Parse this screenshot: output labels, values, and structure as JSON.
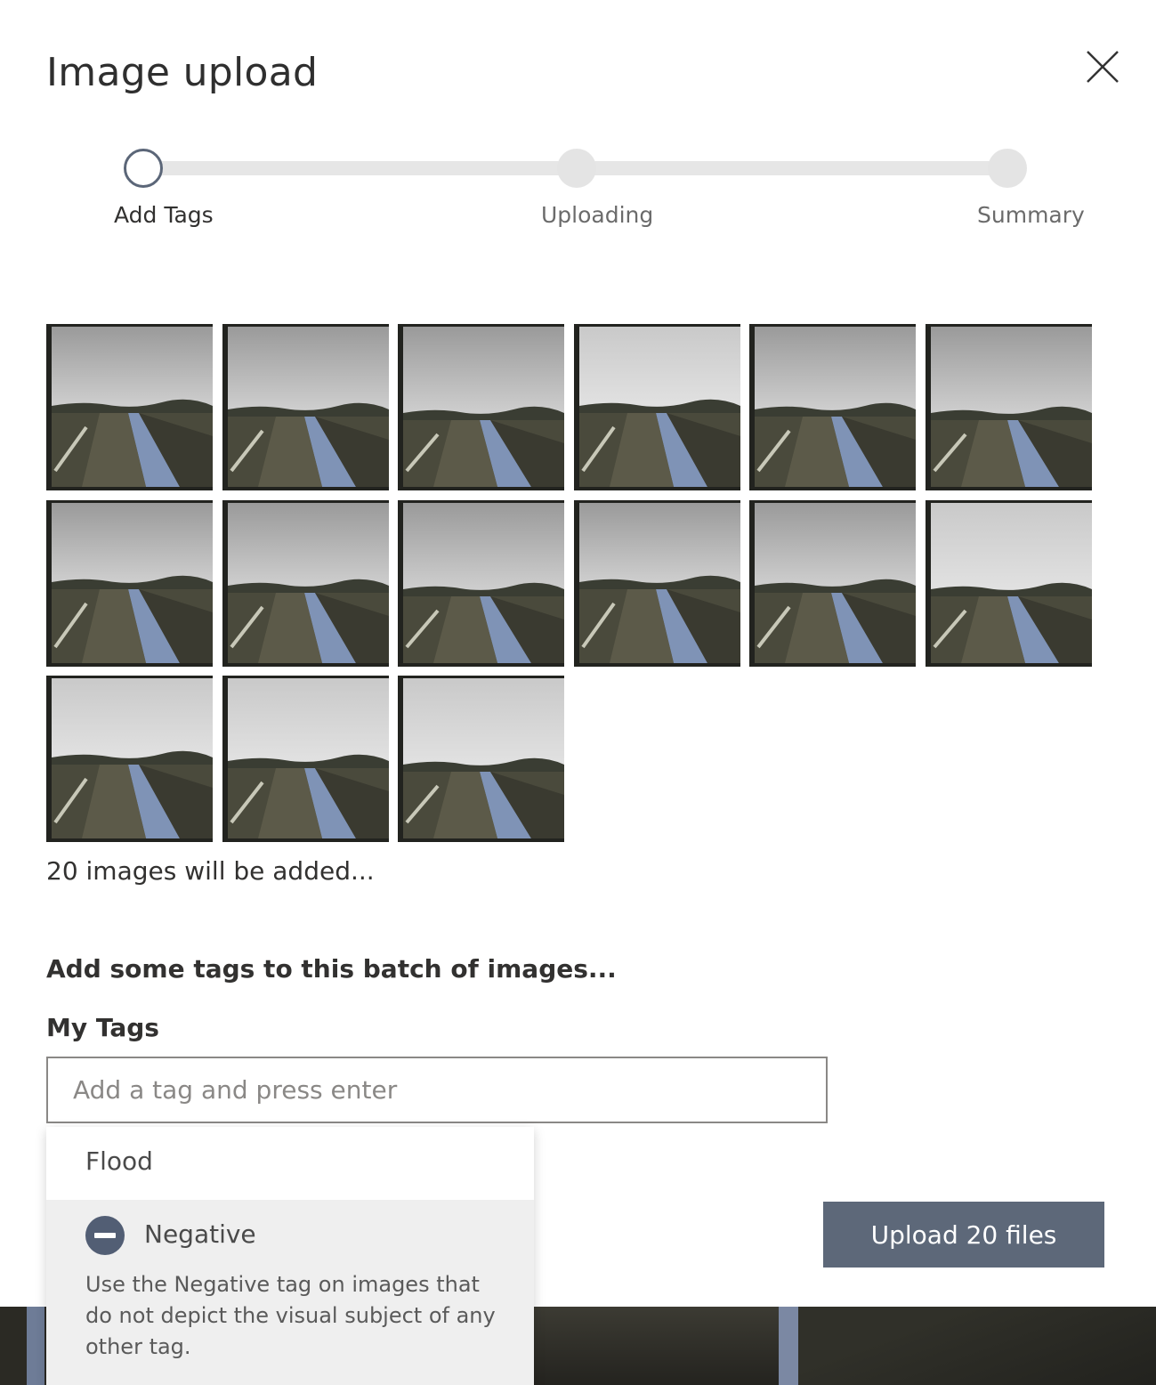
{
  "dialog": {
    "title": "Image upload"
  },
  "stepper": {
    "steps": [
      {
        "label": "Add Tags",
        "state": "active"
      },
      {
        "label": "Uploading",
        "state": "pending"
      },
      {
        "label": "Summary",
        "state": "pending"
      }
    ]
  },
  "images": {
    "thumbnail_count": 15,
    "count_text": "20 images will be added..."
  },
  "tags": {
    "section_title": "Add some tags to this batch of images...",
    "field_label": "My Tags",
    "input_value": "",
    "input_placeholder": "Add a tag and press enter",
    "suggestions": [
      {
        "label": "Flood"
      },
      {
        "label": "Negative",
        "icon": "minus-circle-icon",
        "description": "Use the Negative tag on images that do not depict the visual subject of any other tag."
      }
    ]
  },
  "actions": {
    "upload_label": "Upload 20 files"
  },
  "colors": {
    "accent": "#5d6879",
    "negative_icon": "#525e74"
  }
}
